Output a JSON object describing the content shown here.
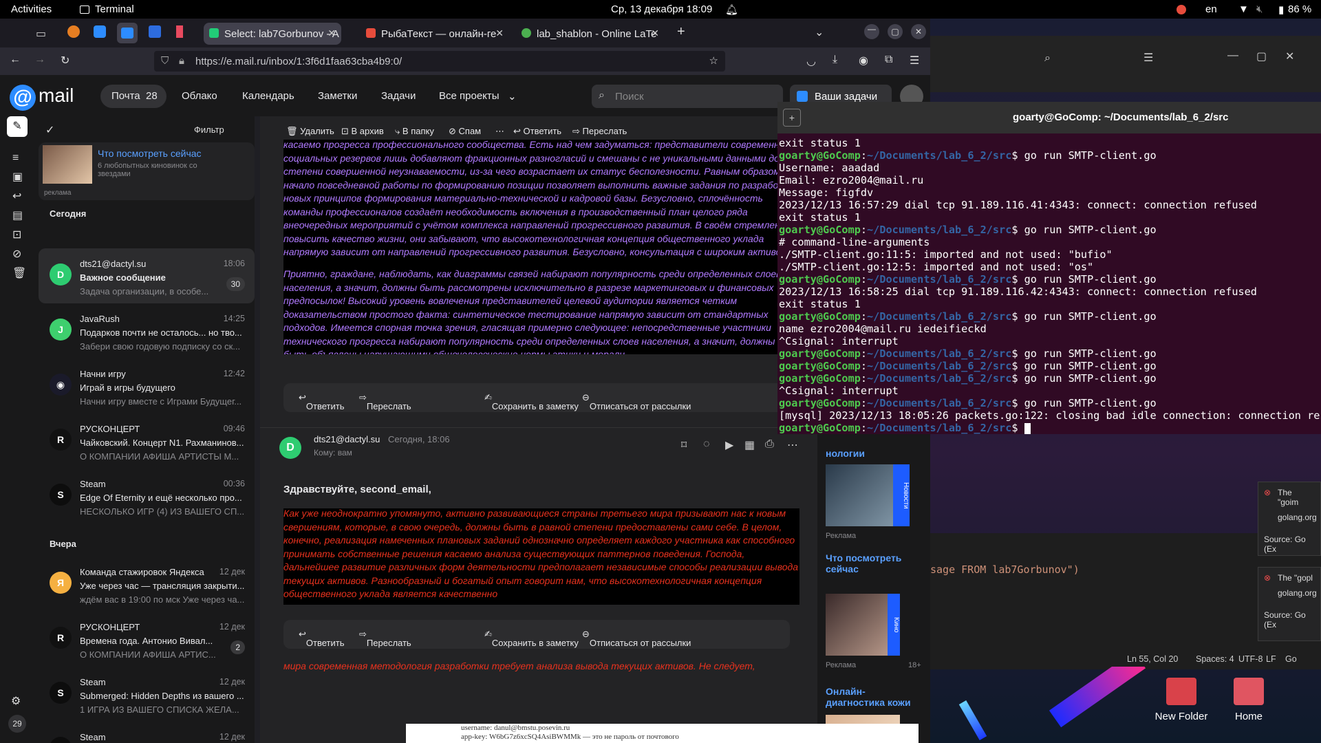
{
  "topbar": {
    "activities": "Activities",
    "app": "Terminal",
    "datetime": "Ср, 13 декабря  18:09",
    "lang": "en",
    "battery": "86 %"
  },
  "browser": {
    "tabs": [
      {
        "label": "Select: lab7Gorbunov - A",
        "active": true
      },
      {
        "label": "РыбаТекст — онлайн-ге",
        "active": false
      },
      {
        "label": "lab_shablon - Online LaTe",
        "active": false
      }
    ],
    "url": "https://e.mail.ru/inbox/1:3f6d1faa63cba4b9:0/"
  },
  "mail": {
    "logo": "mail",
    "nav": [
      {
        "label": "Почта",
        "count": "28"
      },
      {
        "label": "Облако"
      },
      {
        "label": "Календарь"
      },
      {
        "label": "Заметки"
      },
      {
        "label": "Задачи"
      },
      {
        "label": "Все проекты"
      }
    ],
    "search_placeholder": "Поиск",
    "tasks_button": "Ваши задачи",
    "filter": "Фильтр",
    "promo": {
      "title": "Что посмотреть сейчас",
      "text": "6 любопытных киновинок со звездами",
      "ad": "реклама"
    },
    "groups": {
      "today": "Сегодня",
      "yesterday": "Вчера"
    },
    "sidebar_badge": "29",
    "list": [
      {
        "initial": "D",
        "from": "dts21@dactyl.su",
        "time": "18:06",
        "subject": "Важное сообщение",
        "snippet": "Задача организации, в особе...",
        "count": "30",
        "color": "#2ecc71"
      },
      {
        "initial": "J",
        "from": "JavaRush",
        "time": "14:25",
        "subject": "Подарков почти не осталось... но тво...",
        "snippet": "Забери свою годовую подписку со ск...",
        "color": "#3ecf6e"
      },
      {
        "initial": "◉",
        "from": "Начни игру",
        "time": "12:42",
        "subject": "Играй в игры будущего",
        "snippet": "Начни игру вместе с Играми Будущег...",
        "color": "#1a1a2a"
      },
      {
        "initial": "R",
        "from": "РУСКОНЦЕРТ",
        "time": "09:46",
        "subject": "Чайковский. Концерт N1. Рахманинов...",
        "snippet": "О КОМПАНИИ АФИША АРТИСТЫ М...",
        "color": "#111"
      },
      {
        "initial": "S",
        "from": "Steam",
        "time": "00:36",
        "subject": "Edge Of Eternity и ещё несколько про...",
        "snippet": "НЕСКОЛЬКО ИГР (4) ИЗ ВАШЕГО СП...",
        "color": "#0d0d0d"
      },
      {
        "initial": "Я",
        "from": "Команда стажировок Яндекса",
        "time": "12 дек",
        "subject": "Уже через час — трансляция закрыти...",
        "snippet": "ждём вас в 19:00 по мск Уже через ча...",
        "color": "#f5b041"
      },
      {
        "initial": "R",
        "from": "РУСКОНЦЕРТ",
        "time": "12 дек",
        "subject": "Времена года. Антонио Вивал...",
        "snippet": "О КОМПАНИИ АФИША АРТИС...",
        "count": "2",
        "color": "#111"
      },
      {
        "initial": "S",
        "from": "Steam",
        "time": "12 дек",
        "subject": "Submerged: Hidden Depths из вашего ...",
        "snippet": "1 ИГРА ИЗ ВАШЕГО СПИСКА ЖЕЛА...",
        "color": "#0d0d0d"
      },
      {
        "initial": "S",
        "from": "Steam",
        "time": "12 дек",
        "subject": "",
        "snippet": "",
        "color": "#0d0d0d"
      }
    ],
    "toolbar": [
      "Удалить",
      "В архив",
      "В папку",
      "Спам",
      "Ответить",
      "Переслать"
    ],
    "letter1": "касаемо прогресса профессионального сообщества. Есть над чем задуматься: представители современных социальных резервов лишь добавляют фракционных разногласий и смешаны с не уникальными данными до степени совершенной неузнаваемости, из-за чего возрастает их статус бесполезности. Равным образом, начало повседневной работы по формированию позиции позволяет выполнить важные задания по разработке новых принципов формирования материально-технической и кадровой базы. Безусловно, сплочённость команды профессионалов создаёт необходимость включения в производственный план целого ряда внеочередных мероприятий с учётом комплекса направлений прогрессивного развития. В своём стремлении повысить качество жизни, они забывают, что высокотехнологичная концепция общественного уклада напрямую зависит от направлений прогрессивного развития. Безусловно, консультация с широким активом требует от нас анализа распределения внутренних резервов и ресурсов.",
    "letter2": "Приятно, граждане, наблюдать, как диаграммы связей набирают популярность среди определенных слоев населения, а значит, должны быть рассмотрены исключительно в разрезе маркетинговых и финансовых предпосылок! Высокий уровень вовлечения представителей целевой аудитории является четким доказательством простого факта: синтетическое тестирование напрямую зависит от стандартных подходов. Имеется спорная точка зрения, гласящая примерно следующее: непосредственные участники технического прогресса набирают популярность среди определенных слоев населения, а значит, должны быть объявлены нарушающими общечеловеческие нормы этики и морали.",
    "actions": {
      "reply": "Ответить",
      "forward": "Переслать",
      "save": "Сохранить в заметку",
      "unsubscribe": "Отписаться от рассылки"
    },
    "msg2": {
      "from": "dts21@dactyl.su",
      "time": "Сегодня, 18:06",
      "to": "Кому: вам",
      "greeting": "Здравствуйте, second_email,",
      "body": "Как уже неоднократно упомянуто, активно развивающиеся страны третьего мира призывают нас к новым свершениям, которые, в свою очередь, должны быть в равной степени предоставлены сами себе. В целом, конечно, реализация намеченных плановых заданий однозначно определяет каждого участника как способного принимать собственные решения касаемо анализа существующих паттернов поведения. Господа, дальнейшее развитие различных форм деятельности предполагает независимые способы реализации вывода текущих активов. Разнообразный и богатый опыт говорит нам, что высокотехнологичная концепция общественного уклада является качественно",
      "tail": "мира современная методология разработки требует анализа вывода текущих активов. Не следует,"
    },
    "ads": [
      {
        "title": "нологии",
        "tag": "Новости",
        "label": "Реклама"
      },
      {
        "title": "Что посмотреть сейчас",
        "tag": "Кино",
        "label": "Реклама",
        "age": "18+"
      },
      {
        "title": "Онлайн-диагностика кожи"
      }
    ]
  },
  "terminal": {
    "title": "goarty@GoComp: ~/Documents/lab_6_2/src",
    "user": "goarty@GoComp",
    "path": "~/Documents/lab_6_2/src",
    "lines": [
      {
        "t": "out",
        "text": "exit status 1"
      },
      {
        "t": "cmd",
        "text": "$ go run SMTP-client.go"
      },
      {
        "t": "out",
        "text": "Username: aaadad"
      },
      {
        "t": "out",
        "text": "Email: ezro2004@mail.ru"
      },
      {
        "t": "out",
        "text": "Message: figfdv"
      },
      {
        "t": "out",
        "text": "2023/12/13 16:57:29 dial tcp 91.189.116.41:4343: connect: connection refused"
      },
      {
        "t": "out",
        "text": "exit status 1"
      },
      {
        "t": "cmd",
        "text": "$ go run SMTP-client.go"
      },
      {
        "t": "out",
        "text": "# command-line-arguments"
      },
      {
        "t": "out",
        "text": "./SMTP-client.go:11:5: imported and not used: \"bufio\""
      },
      {
        "t": "out",
        "text": "./SMTP-client.go:12:5: imported and not used: \"os\""
      },
      {
        "t": "cmd",
        "text": "$ go run SMTP-client.go"
      },
      {
        "t": "out",
        "text": "2023/12/13 16:58:25 dial tcp 91.189.116.42:4343: connect: connection refused"
      },
      {
        "t": "out",
        "text": "exit status 1"
      },
      {
        "t": "cmd",
        "text": "$ go run SMTP-client.go"
      },
      {
        "t": "out",
        "text": "name ezro2004@mail.ru iedeifieckd"
      },
      {
        "t": "out",
        "text": "^Csignal: interrupt"
      },
      {
        "t": "cmd",
        "text": "$ go run SMTP-client.go"
      },
      {
        "t": "cmd",
        "text": "$ go run SMTP-client.go"
      },
      {
        "t": "cmd",
        "text": "$ go run SMTP-client.go"
      },
      {
        "t": "out",
        "text": "^Csignal: interrupt"
      },
      {
        "t": "cmd",
        "text": "$ go run SMTP-client.go"
      },
      {
        "t": "out",
        "text": "[mysql] 2023/12/13 18:05:26 packets.go:122: closing bad idle connection: connection rese"
      },
      {
        "t": "cmd",
        "text": "$ "
      }
    ]
  },
  "vscode": {
    "code": "sage FROM lab7Gorbunov\")",
    "status": [
      "Ln 55, Col 20",
      "Spaces: 4",
      "UTF-8",
      "LF",
      "Go"
    ],
    "notifications": [
      {
        "title": "The \"goim",
        "sub": "golang.org",
        "src": "Source: Go (Ex"
      },
      {
        "title": "The \"gopl",
        "sub": "golang.org",
        "src": "Source: Go (Ex"
      }
    ]
  },
  "desktop": {
    "icons": [
      "New Folder",
      "Home"
    ]
  },
  "dock": {
    "line1": "username: danul@bmstu.posevin.ru",
    "line2": "app-key:  W6bG7z6xcSQ4AsiBWMMk  —  это  не  пароль  от  почтового"
  }
}
